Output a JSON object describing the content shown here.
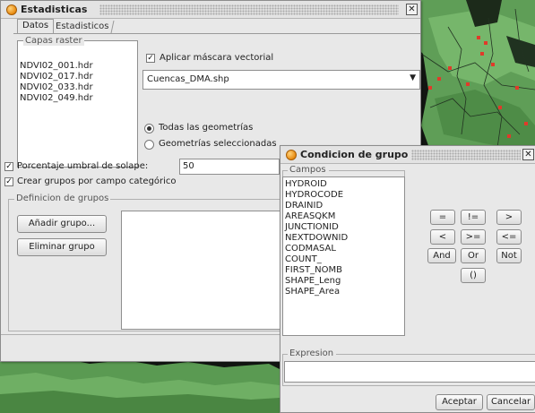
{
  "estadisticas": {
    "title": "Estadisticas",
    "tabs": [
      {
        "label": "Datos"
      },
      {
        "label": "Estadisticos"
      }
    ],
    "capas_raster": {
      "label": "Capas raster",
      "items": [
        "NDVI02_001.hdr",
        "NDVI02_017.hdr",
        "NDVI02_033.hdr",
        "NDVI02_049.hdr"
      ]
    },
    "aplicar_mascara": {
      "label": "Aplicar máscara vectorial",
      "checked": true
    },
    "shapefile": {
      "value": "Cuencas_DMA.shp"
    },
    "geometry_options": [
      {
        "label": "Todas las geometrías",
        "selected": true
      },
      {
        "label": "Geometrías seleccionadas",
        "selected": false
      }
    ],
    "porcentaje": {
      "label": "Porcentaje umbral de solape:",
      "value": "50",
      "checked": true
    },
    "crear_grupos": {
      "label": "Crear grupos por campo categórico",
      "checked": true
    },
    "definicion": {
      "label": "Definicion de grupos",
      "add_button": "Añadir grupo...",
      "delete_button": "Eliminar grupo"
    }
  },
  "condicion": {
    "title": "Condicion de grupo",
    "campos": {
      "label": "Campos",
      "items": [
        "HYDROID",
        "HYDROCODE",
        "DRAINID",
        "AREASQKM",
        "JUNCTIONID",
        "NEXTDOWNID",
        "CODMASAL",
        "COUNT_",
        "FIRST_NOMB",
        "SHAPE_Leng",
        "SHAPE_Area"
      ]
    },
    "operators": [
      "=",
      "!=",
      ">",
      "<",
      ">=",
      "<=",
      "And",
      "Or",
      "Not",
      "()"
    ],
    "expresion": {
      "label": "Expresion",
      "value": ""
    },
    "accept_button": "Aceptar",
    "cancel_button": "Cancelar"
  },
  "colors": {
    "map_green": "#5b9a52",
    "map_dark": "#101410",
    "map_point": "#e03a2a"
  }
}
